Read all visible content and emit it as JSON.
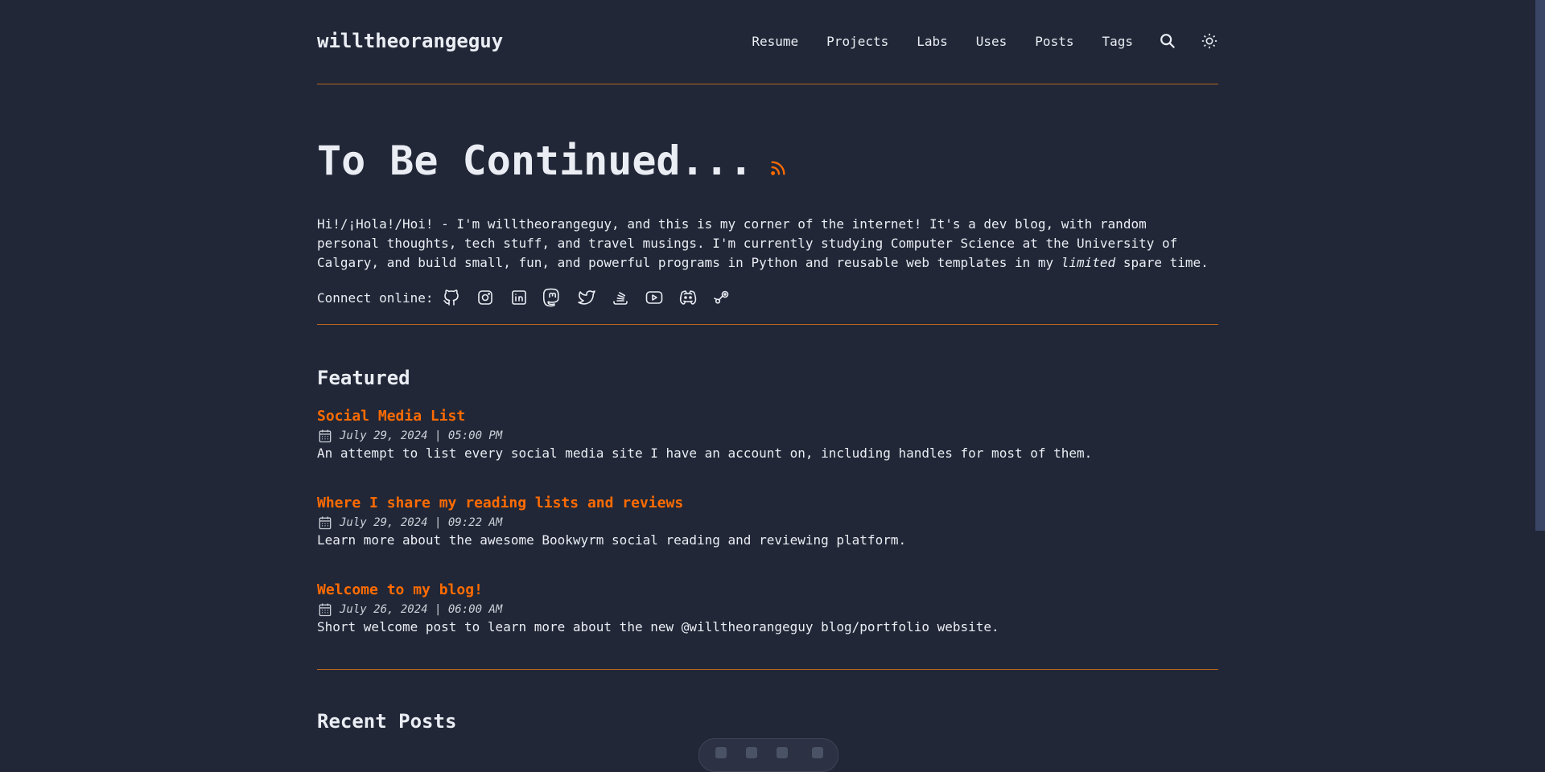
{
  "site": {
    "title": "willtheorangeguy"
  },
  "nav": {
    "items": [
      {
        "label": "Resume"
      },
      {
        "label": "Projects"
      },
      {
        "label": "Labs"
      },
      {
        "label": "Uses"
      },
      {
        "label": "Posts"
      },
      {
        "label": "Tags"
      }
    ],
    "search_icon": "search-icon",
    "theme_icon": "sun-icon"
  },
  "hero": {
    "title": "To Be Continued...",
    "rss_icon": "rss-icon",
    "intro_before": "Hi!/¡Hola!/Hoi! - I'm willtheorangeguy, and this is my corner of the internet! It's a dev blog, with random personal thoughts, tech stuff, and travel musings. I'm currently studying Computer Science at the University of Calgary, and build small, fun, and powerful programs in Python and reusable web templates in my ",
    "intro_em": "limited",
    "intro_after": " spare time.",
    "connect_label": "Connect online:",
    "socials": [
      "github-icon",
      "instagram-icon",
      "linkedin-icon",
      "mastodon-icon",
      "twitter-icon",
      "stackoverflow-icon",
      "youtube-icon",
      "discord-icon",
      "steam-icon"
    ]
  },
  "featured": {
    "heading": "Featured",
    "posts": [
      {
        "title": "Social Media List",
        "date": "July 29, 2024 | 05:00 PM",
        "desc": "An attempt to list every social media site I have an account on, including handles for most of them."
      },
      {
        "title": "Where I share my reading lists and reviews",
        "date": "July 29, 2024 | 09:22 AM",
        "desc": "Learn more about the awesome Bookwyrm social reading and reviewing platform."
      },
      {
        "title": "Welcome to my blog!",
        "date": "July 26, 2024 | 06:00 AM",
        "desc": "Short welcome post to learn more about the new @willtheorangeguy blog/portfolio website."
      }
    ]
  },
  "recent": {
    "heading": "Recent Posts"
  },
  "colors": {
    "background": "#212737",
    "accent": "#ff6b01",
    "text": "#eaedf3",
    "divider": "#b8641f"
  }
}
